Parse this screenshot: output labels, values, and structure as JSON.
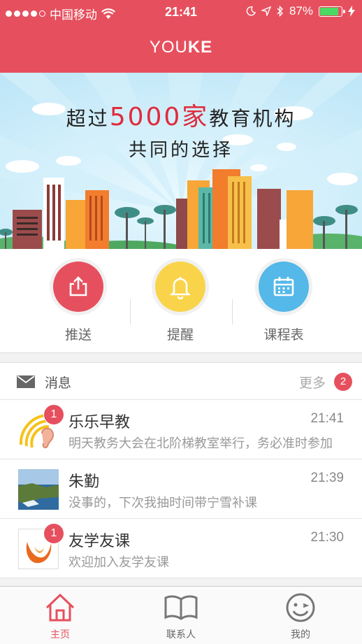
{
  "status_bar": {
    "carrier": "中国移动",
    "time": "21:41",
    "battery": "87%",
    "battery_level": 0.87
  },
  "header": {
    "title_light": "YOU",
    "title_bold": "KE"
  },
  "banner": {
    "line1_pre": "超过",
    "line1_highlight": "5000家",
    "line1_post": "教育机构",
    "line2": "共同的选择"
  },
  "quick_actions": [
    {
      "label": "推送",
      "icon": "share-icon",
      "color": "#e6505e"
    },
    {
      "label": "提醒",
      "icon": "bell-icon",
      "color": "#f9d44a"
    },
    {
      "label": "课程表",
      "icon": "calendar-icon",
      "color": "#54b8e8"
    }
  ],
  "messages": {
    "title": "消息",
    "more_label": "更多",
    "more_count": "2",
    "items": [
      {
        "name": "乐乐早教",
        "time": "21:41",
        "preview": "明天教务大会在北阶梯教室举行，务必准时参加",
        "badge": "1",
        "avatar": "ear-logo"
      },
      {
        "name": "朱勤",
        "time": "21:39",
        "preview": "没事的，下次我抽时间带宁雪补课",
        "badge": "",
        "avatar": "coast-photo"
      },
      {
        "name": "友学友课",
        "time": "21:30",
        "preview": "欢迎加入友学友课",
        "badge": "1",
        "avatar": "y-logo"
      }
    ]
  },
  "tabbar": {
    "items": [
      {
        "label": "主页",
        "icon": "home-icon",
        "active": true
      },
      {
        "label": "联系人",
        "icon": "book-icon",
        "active": false
      },
      {
        "label": "我的",
        "icon": "smiley-icon",
        "active": false
      }
    ]
  },
  "colors": {
    "brand": "#e6505e",
    "sky": "#c9ecfa"
  }
}
